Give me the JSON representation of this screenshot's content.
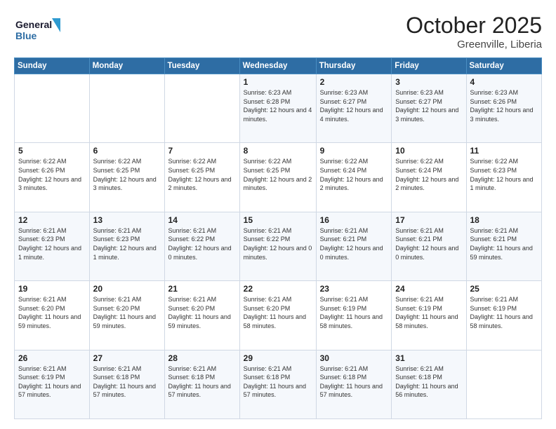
{
  "header": {
    "logo_general": "General",
    "logo_blue": "Blue",
    "month_title": "October 2025",
    "location": "Greenville, Liberia"
  },
  "days_of_week": [
    "Sunday",
    "Monday",
    "Tuesday",
    "Wednesday",
    "Thursday",
    "Friday",
    "Saturday"
  ],
  "weeks": [
    [
      {
        "day": "",
        "sunrise": "",
        "sunset": "",
        "daylight": ""
      },
      {
        "day": "",
        "sunrise": "",
        "sunset": "",
        "daylight": ""
      },
      {
        "day": "",
        "sunrise": "",
        "sunset": "",
        "daylight": ""
      },
      {
        "day": "1",
        "sunrise": "6:23 AM",
        "sunset": "6:28 PM",
        "daylight": "12 hours and 4 minutes."
      },
      {
        "day": "2",
        "sunrise": "6:23 AM",
        "sunset": "6:27 PM",
        "daylight": "12 hours and 4 minutes."
      },
      {
        "day": "3",
        "sunrise": "6:23 AM",
        "sunset": "6:27 PM",
        "daylight": "12 hours and 3 minutes."
      },
      {
        "day": "4",
        "sunrise": "6:23 AM",
        "sunset": "6:26 PM",
        "daylight": "12 hours and 3 minutes."
      }
    ],
    [
      {
        "day": "5",
        "sunrise": "6:22 AM",
        "sunset": "6:26 PM",
        "daylight": "12 hours and 3 minutes."
      },
      {
        "day": "6",
        "sunrise": "6:22 AM",
        "sunset": "6:25 PM",
        "daylight": "12 hours and 3 minutes."
      },
      {
        "day": "7",
        "sunrise": "6:22 AM",
        "sunset": "6:25 PM",
        "daylight": "12 hours and 2 minutes."
      },
      {
        "day": "8",
        "sunrise": "6:22 AM",
        "sunset": "6:25 PM",
        "daylight": "12 hours and 2 minutes."
      },
      {
        "day": "9",
        "sunrise": "6:22 AM",
        "sunset": "6:24 PM",
        "daylight": "12 hours and 2 minutes."
      },
      {
        "day": "10",
        "sunrise": "6:22 AM",
        "sunset": "6:24 PM",
        "daylight": "12 hours and 2 minutes."
      },
      {
        "day": "11",
        "sunrise": "6:22 AM",
        "sunset": "6:23 PM",
        "daylight": "12 hours and 1 minute."
      }
    ],
    [
      {
        "day": "12",
        "sunrise": "6:21 AM",
        "sunset": "6:23 PM",
        "daylight": "12 hours and 1 minute."
      },
      {
        "day": "13",
        "sunrise": "6:21 AM",
        "sunset": "6:23 PM",
        "daylight": "12 hours and 1 minute."
      },
      {
        "day": "14",
        "sunrise": "6:21 AM",
        "sunset": "6:22 PM",
        "daylight": "12 hours and 0 minutes."
      },
      {
        "day": "15",
        "sunrise": "6:21 AM",
        "sunset": "6:22 PM",
        "daylight": "12 hours and 0 minutes."
      },
      {
        "day": "16",
        "sunrise": "6:21 AM",
        "sunset": "6:21 PM",
        "daylight": "12 hours and 0 minutes."
      },
      {
        "day": "17",
        "sunrise": "6:21 AM",
        "sunset": "6:21 PM",
        "daylight": "12 hours and 0 minutes."
      },
      {
        "day": "18",
        "sunrise": "6:21 AM",
        "sunset": "6:21 PM",
        "daylight": "11 hours and 59 minutes."
      }
    ],
    [
      {
        "day": "19",
        "sunrise": "6:21 AM",
        "sunset": "6:20 PM",
        "daylight": "11 hours and 59 minutes."
      },
      {
        "day": "20",
        "sunrise": "6:21 AM",
        "sunset": "6:20 PM",
        "daylight": "11 hours and 59 minutes."
      },
      {
        "day": "21",
        "sunrise": "6:21 AM",
        "sunset": "6:20 PM",
        "daylight": "11 hours and 59 minutes."
      },
      {
        "day": "22",
        "sunrise": "6:21 AM",
        "sunset": "6:20 PM",
        "daylight": "11 hours and 58 minutes."
      },
      {
        "day": "23",
        "sunrise": "6:21 AM",
        "sunset": "6:19 PM",
        "daylight": "11 hours and 58 minutes."
      },
      {
        "day": "24",
        "sunrise": "6:21 AM",
        "sunset": "6:19 PM",
        "daylight": "11 hours and 58 minutes."
      },
      {
        "day": "25",
        "sunrise": "6:21 AM",
        "sunset": "6:19 PM",
        "daylight": "11 hours and 58 minutes."
      }
    ],
    [
      {
        "day": "26",
        "sunrise": "6:21 AM",
        "sunset": "6:19 PM",
        "daylight": "11 hours and 57 minutes."
      },
      {
        "day": "27",
        "sunrise": "6:21 AM",
        "sunset": "6:18 PM",
        "daylight": "11 hours and 57 minutes."
      },
      {
        "day": "28",
        "sunrise": "6:21 AM",
        "sunset": "6:18 PM",
        "daylight": "11 hours and 57 minutes."
      },
      {
        "day": "29",
        "sunrise": "6:21 AM",
        "sunset": "6:18 PM",
        "daylight": "11 hours and 57 minutes."
      },
      {
        "day": "30",
        "sunrise": "6:21 AM",
        "sunset": "6:18 PM",
        "daylight": "11 hours and 57 minutes."
      },
      {
        "day": "31",
        "sunrise": "6:21 AM",
        "sunset": "6:18 PM",
        "daylight": "11 hours and 56 minutes."
      },
      {
        "day": "",
        "sunrise": "",
        "sunset": "",
        "daylight": ""
      }
    ]
  ]
}
